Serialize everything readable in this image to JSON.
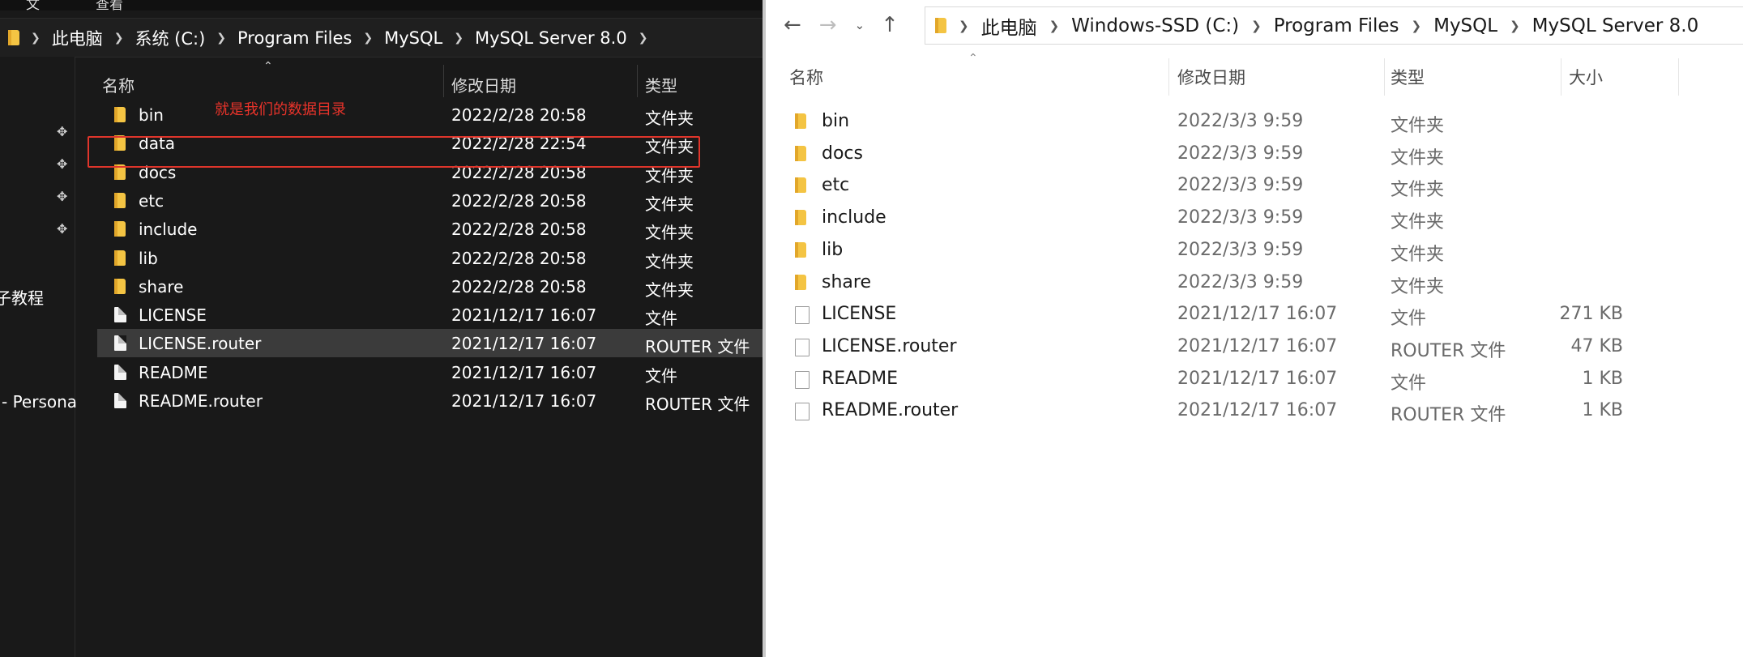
{
  "left_explorer": {
    "top_strip": [
      "文",
      "查看"
    ],
    "breadcrumb": [
      "此电脑",
      "系统 (C:)",
      "Program Files",
      "MySQL",
      "MySQL Server 8.0"
    ],
    "nav_partial_labels": [
      "子教程",
      "- Persona"
    ],
    "columns": {
      "name": "名称",
      "date": "修改日期",
      "type": "类型"
    },
    "annotation": "就是我们的数据目录",
    "files": [
      {
        "name": "bin",
        "date": "2022/2/28 20:58",
        "type": "文件夹",
        "kind": "folder"
      },
      {
        "name": "data",
        "date": "2022/2/28 22:54",
        "type": "文件夹",
        "kind": "folder"
      },
      {
        "name": "docs",
        "date": "2022/2/28 20:58",
        "type": "文件夹",
        "kind": "folder"
      },
      {
        "name": "etc",
        "date": "2022/2/28 20:58",
        "type": "文件夹",
        "kind": "folder"
      },
      {
        "name": "include",
        "date": "2022/2/28 20:58",
        "type": "文件夹",
        "kind": "folder"
      },
      {
        "name": "lib",
        "date": "2022/2/28 20:58",
        "type": "文件夹",
        "kind": "folder"
      },
      {
        "name": "share",
        "date": "2022/2/28 20:58",
        "type": "文件夹",
        "kind": "folder"
      },
      {
        "name": "LICENSE",
        "date": "2021/12/17 16:07",
        "type": "文件",
        "kind": "file"
      },
      {
        "name": "LICENSE.router",
        "date": "2021/12/17 16:07",
        "type": "ROUTER 文件",
        "kind": "file"
      },
      {
        "name": "README",
        "date": "2021/12/17 16:07",
        "type": "文件",
        "kind": "file"
      },
      {
        "name": "README.router",
        "date": "2021/12/17 16:07",
        "type": "ROUTER 文件",
        "kind": "file"
      }
    ],
    "selected_row": "LICENSE.router",
    "highlighted_row": "data"
  },
  "right_explorer": {
    "nav_buttons": {
      "back": "←",
      "forward": "→",
      "recent": "⌄",
      "up": "↑"
    },
    "breadcrumb": [
      "此电脑",
      "Windows-SSD (C:)",
      "Program Files",
      "MySQL",
      "MySQL Server 8.0"
    ],
    "columns": {
      "name": "名称",
      "date": "修改日期",
      "type": "类型",
      "size": "大小"
    },
    "files": [
      {
        "name": "bin",
        "date": "2022/3/3 9:59",
        "type": "文件夹",
        "size": "",
        "kind": "folder"
      },
      {
        "name": "docs",
        "date": "2022/3/3 9:59",
        "type": "文件夹",
        "size": "",
        "kind": "folder"
      },
      {
        "name": "etc",
        "date": "2022/3/3 9:59",
        "type": "文件夹",
        "size": "",
        "kind": "folder"
      },
      {
        "name": "include",
        "date": "2022/3/3 9:59",
        "type": "文件夹",
        "size": "",
        "kind": "folder"
      },
      {
        "name": "lib",
        "date": "2022/3/3 9:59",
        "type": "文件夹",
        "size": "",
        "kind": "folder"
      },
      {
        "name": "share",
        "date": "2022/3/3 9:59",
        "type": "文件夹",
        "size": "",
        "kind": "folder"
      },
      {
        "name": "LICENSE",
        "date": "2021/12/17 16:07",
        "type": "文件",
        "size": "271 KB",
        "kind": "file"
      },
      {
        "name": "LICENSE.router",
        "date": "2021/12/17 16:07",
        "type": "ROUTER 文件",
        "size": "47 KB",
        "kind": "file"
      },
      {
        "name": "README",
        "date": "2021/12/17 16:07",
        "type": "文件",
        "size": "1 KB",
        "kind": "file"
      },
      {
        "name": "README.router",
        "date": "2021/12/17 16:07",
        "type": "ROUTER 文件",
        "size": "1 KB",
        "kind": "file"
      }
    ]
  },
  "colors": {
    "dark_bg": "#191919",
    "folder_yellow": "#f4c443",
    "annotation_red": "#e0352b",
    "selected_row_dark": "#3b3b3b"
  },
  "icons": {
    "folder": "folder-icon",
    "file": "file-icon",
    "pin": "pin-icon",
    "chevron": "chevron-right-icon"
  }
}
